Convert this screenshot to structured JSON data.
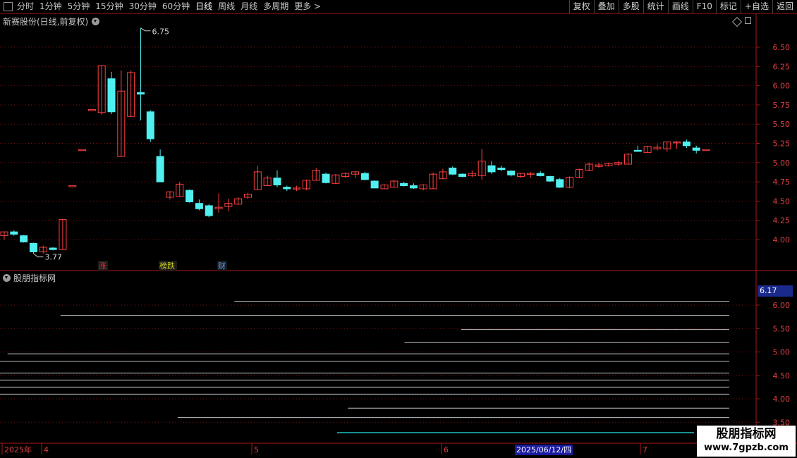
{
  "toolbar": {
    "periods": [
      "分时",
      "1分钟",
      "5分钟",
      "15分钟",
      "30分钟",
      "60分钟",
      "日线",
      "周线",
      "月线",
      "多周期",
      "更多 >"
    ],
    "active_period": "日线",
    "buttons": [
      "复权",
      "叠加",
      "多股",
      "统计",
      "画线",
      "F10",
      "标记",
      "+自选",
      "返回"
    ]
  },
  "main_chart": {
    "title": "新赛股份(日线,前复权)",
    "high_marker": "6.75",
    "low_marker": "3.77",
    "event_labels": [
      {
        "text": "涨",
        "color": "#e03030"
      },
      {
        "text": "榜跌",
        "color": "#d0d020"
      },
      {
        "text": "财",
        "color": "#60a0ff"
      }
    ],
    "y_ticks": [
      "6.50",
      "6.25",
      "6.00",
      "5.75",
      "5.50",
      "5.25",
      "5.00",
      "4.75",
      "4.50",
      "4.25",
      "4.00"
    ]
  },
  "sub_chart": {
    "title": "股朋指标网",
    "price_box": "6.17",
    "y_ticks": [
      "6.00",
      "5.50",
      "5.00",
      "4.50",
      "4.00",
      "3.50"
    ]
  },
  "x_axis": {
    "labels": [
      "2025年",
      "4",
      "5",
      "6",
      "7"
    ],
    "selected_date": "2025/06/12/四"
  },
  "watermark": {
    "line1": "股朋指标网",
    "line2": "www.7gpzb.com"
  },
  "colors": {
    "up": "#ff4040",
    "down": "#50f0f0",
    "axis": "#aa1818",
    "grid": "#7a1010"
  },
  "chart_data": {
    "type": "candlestick",
    "ylim": [
      3.6,
      6.8
    ],
    "candles": [
      [
        4.05,
        4.1,
        4.0,
        4.1
      ],
      [
        4.1,
        4.12,
        4.05,
        4.07
      ],
      [
        4.05,
        4.06,
        3.96,
        3.97
      ],
      [
        3.95,
        3.96,
        3.82,
        3.84
      ],
      [
        3.84,
        3.92,
        3.82,
        3.9
      ],
      [
        3.89,
        3.9,
        3.86,
        3.87
      ],
      [
        3.87,
        4.27,
        3.87,
        4.26
      ],
      [
        4.7,
        4.7,
        4.7,
        4.7
      ],
      [
        5.17,
        5.17,
        5.17,
        5.17
      ],
      [
        5.69,
        5.69,
        5.69,
        5.69
      ],
      [
        5.65,
        6.26,
        5.62,
        6.26
      ],
      [
        6.09,
        6.18,
        5.63,
        5.66
      ],
      [
        5.08,
        6.2,
        5.08,
        5.93
      ],
      [
        5.6,
        6.2,
        5.6,
        6.17
      ],
      [
        5.91,
        6.75,
        5.55,
        5.89
      ],
      [
        5.66,
        5.68,
        5.27,
        5.31
      ],
      [
        5.08,
        5.17,
        4.75,
        4.75
      ],
      [
        4.55,
        4.63,
        4.52,
        4.62
      ],
      [
        4.56,
        4.75,
        4.56,
        4.72
      ],
      [
        4.64,
        4.65,
        4.48,
        4.49
      ],
      [
        4.47,
        4.52,
        4.38,
        4.4
      ],
      [
        4.44,
        4.46,
        4.29,
        4.31
      ],
      [
        4.4,
        4.6,
        4.35,
        4.42
      ],
      [
        4.43,
        4.53,
        4.37,
        4.47
      ],
      [
        4.46,
        4.55,
        4.45,
        4.53
      ],
      [
        4.55,
        4.61,
        4.53,
        4.59
      ],
      [
        4.65,
        4.96,
        4.65,
        4.88
      ],
      [
        4.7,
        4.83,
        4.7,
        4.8
      ],
      [
        4.8,
        4.9,
        4.68,
        4.71
      ],
      [
        4.68,
        4.7,
        4.63,
        4.66
      ],
      [
        4.66,
        4.7,
        4.63,
        4.67
      ],
      [
        4.66,
        4.78,
        4.64,
        4.77
      ],
      [
        4.77,
        4.93,
        4.77,
        4.9
      ],
      [
        4.85,
        4.87,
        4.73,
        4.74
      ],
      [
        4.73,
        4.85,
        4.72,
        4.84
      ],
      [
        4.82,
        4.87,
        4.8,
        4.86
      ],
      [
        4.85,
        4.89,
        4.8,
        4.88
      ],
      [
        4.86,
        4.88,
        4.77,
        4.78
      ],
      [
        4.76,
        4.77,
        4.67,
        4.67
      ],
      [
        4.66,
        4.72,
        4.66,
        4.71
      ],
      [
        4.68,
        4.77,
        4.68,
        4.76
      ],
      [
        4.73,
        4.75,
        4.69,
        4.7
      ],
      [
        4.7,
        4.73,
        4.66,
        4.67
      ],
      [
        4.66,
        4.72,
        4.64,
        4.71
      ],
      [
        4.66,
        4.87,
        4.66,
        4.85
      ],
      [
        4.79,
        4.92,
        4.79,
        4.88
      ],
      [
        4.93,
        4.95,
        4.84,
        4.85
      ],
      [
        4.85,
        4.86,
        4.81,
        4.82
      ],
      [
        4.83,
        4.9,
        4.81,
        4.86
      ],
      [
        4.83,
        5.18,
        4.78,
        5.02
      ],
      [
        4.96,
        5.02,
        4.85,
        4.88
      ],
      [
        4.93,
        4.96,
        4.89,
        4.91
      ],
      [
        4.89,
        4.9,
        4.82,
        4.84
      ],
      [
        4.82,
        4.87,
        4.8,
        4.86
      ],
      [
        4.85,
        4.88,
        4.8,
        4.86
      ],
      [
        4.86,
        4.89,
        4.82,
        4.83
      ],
      [
        4.82,
        4.83,
        4.75,
        4.76
      ],
      [
        4.78,
        4.8,
        4.67,
        4.68
      ],
      [
        4.68,
        4.82,
        4.67,
        4.81
      ],
      [
        4.81,
        4.92,
        4.8,
        4.91
      ],
      [
        4.9,
        5.0,
        4.89,
        4.98
      ],
      [
        4.95,
        5.0,
        4.93,
        4.97
      ],
      [
        4.96,
        5.0,
        4.95,
        4.99
      ],
      [
        4.98,
        5.02,
        4.96,
        5.0
      ],
      [
        4.98,
        5.12,
        4.98,
        5.11
      ],
      [
        5.16,
        5.22,
        5.14,
        5.15
      ],
      [
        5.13,
        5.22,
        5.13,
        5.21
      ],
      [
        5.18,
        5.24,
        5.16,
        5.2
      ],
      [
        5.18,
        5.27,
        5.14,
        5.27
      ],
      [
        5.27,
        5.28,
        5.18,
        5.27
      ],
      [
        5.27,
        5.3,
        5.19,
        5.22
      ],
      [
        5.19,
        5.22,
        5.12,
        5.16
      ],
      [
        5.17,
        5.17,
        5.17,
        5.17
      ]
    ],
    "sub_levels": [
      {
        "value": 6.08,
        "from": 0.31
      },
      {
        "value": 5.78,
        "from": 0.08
      },
      {
        "value": 5.48,
        "from": 0.61
      },
      {
        "value": 5.2,
        "from": 0.535
      },
      {
        "value": 4.96,
        "from": 0.01
      },
      {
        "value": 4.8,
        "from": 0.0
      },
      {
        "value": 4.55,
        "from": 0.0
      },
      {
        "value": 4.4,
        "from": 0.0
      },
      {
        "value": 4.25,
        "from": 0.0
      },
      {
        "value": 4.1,
        "from": 0.0
      },
      {
        "value": 3.8,
        "from": 0.46
      },
      {
        "value": 3.6,
        "from": 0.235
      }
    ],
    "sub_ylim": [
      3.2,
      6.45
    ]
  }
}
